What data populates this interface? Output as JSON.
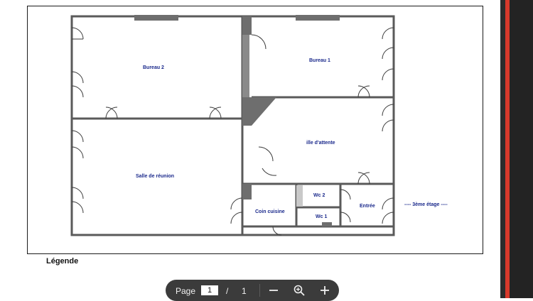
{
  "plan": {
    "rooms": {
      "bureau2": "Bureau 2",
      "bureau1": "Bureau 1",
      "salle_attente": "ille d'attente",
      "salle_reunion": "Salle de réunion",
      "wc2": "Wc 2",
      "wc1": "Wc 1",
      "coin_cuisine": "Coin cuisine",
      "entree": "Entrée",
      "etage": "----  3ème étage  ----"
    }
  },
  "legend": {
    "title": "Légende"
  },
  "toolbar": {
    "page_label": "Page",
    "current_page": "1",
    "separator": "/",
    "total_pages": "1",
    "zoom_out_icon": "minus-icon",
    "zoom_reset_icon": "magnifier-icon",
    "zoom_in_icon": "plus-icon"
  },
  "colors": {
    "wall": "#6e6e6e",
    "label": "#1b2a8c",
    "toolbar_bg": "#3b3b3b",
    "accent_stripe": "#d8392b"
  }
}
